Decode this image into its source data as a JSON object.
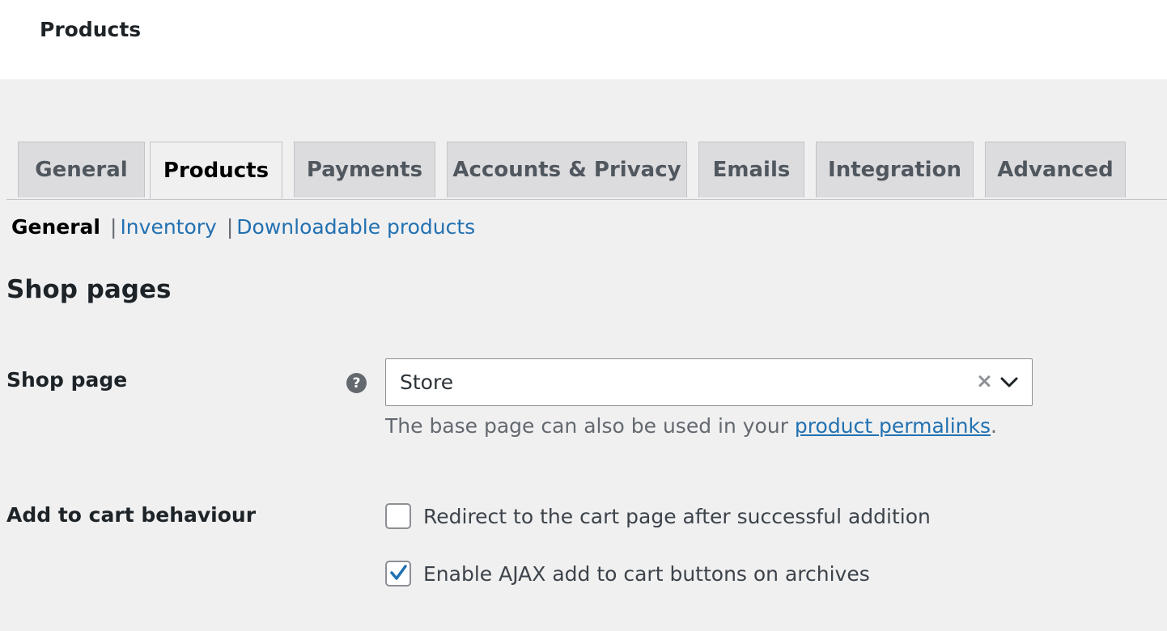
{
  "header": {
    "title": "Products"
  },
  "tabs": [
    {
      "label": "General",
      "active": false
    },
    {
      "label": "Products",
      "active": true
    },
    {
      "label": "Payments",
      "active": false
    },
    {
      "label": "Accounts & Privacy",
      "active": false
    },
    {
      "label": "Emails",
      "active": false
    },
    {
      "label": "Integration",
      "active": false
    },
    {
      "label": "Advanced",
      "active": false
    }
  ],
  "subnav": {
    "current": "General",
    "separator": "|",
    "links": [
      "Inventory",
      "Downloadable products"
    ]
  },
  "section": {
    "title": "Shop pages"
  },
  "shop_page": {
    "label": "Shop page",
    "help_icon": "question-circle-icon",
    "help_glyph": "?",
    "selected": "Store",
    "clear_glyph": "×",
    "description_prefix": "The base page can also be used in your ",
    "description_link": "product permalinks",
    "description_suffix": "."
  },
  "add_to_cart": {
    "label": "Add to cart behaviour",
    "options": [
      {
        "label": "Redirect to the cart page after successful addition",
        "checked": false
      },
      {
        "label": "Enable AJAX add to cart buttons on archives",
        "checked": true
      }
    ]
  },
  "colors": {
    "link": "#2271b1",
    "check": "#2271b1",
    "background": "#f0f0f1"
  }
}
